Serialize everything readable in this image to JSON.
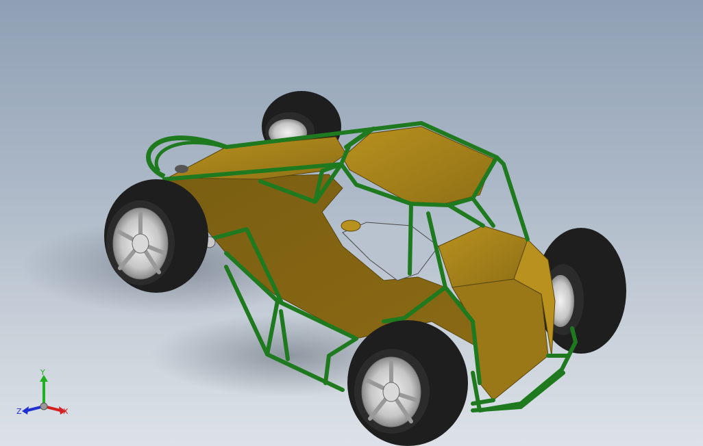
{
  "viewport": {
    "background_top": "#8fa0b4",
    "background_bottom": "#dde2e8"
  },
  "model": {
    "frame_color": "#1f7a1f",
    "panel_color": "#a8841c",
    "panel_shade": "#7a5e12",
    "tire_color": "#1e1e1e",
    "rim_color": "#c8c8c8"
  },
  "triad": {
    "y_label": "Y",
    "x_label": "X",
    "z_label": "Z",
    "y_color": "#22b022",
    "x_color": "#d42020",
    "z_color": "#2030d0"
  }
}
